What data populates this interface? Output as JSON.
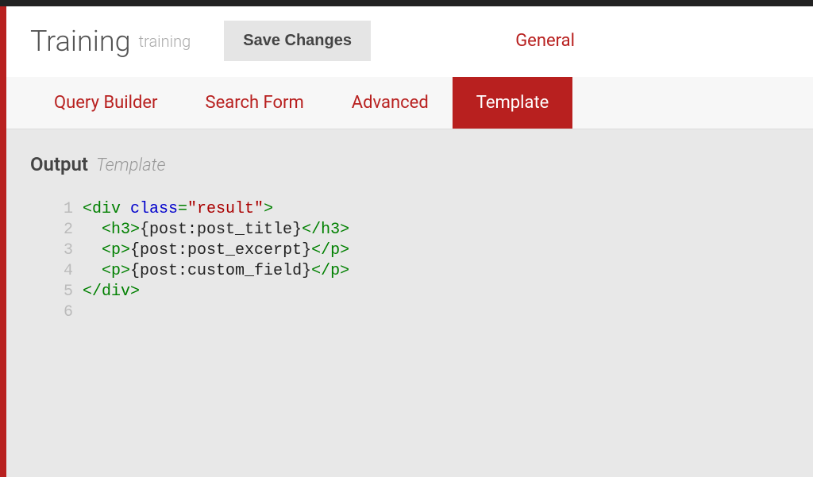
{
  "header": {
    "title": "Training",
    "subtitle": "training",
    "save_button": "Save Changes",
    "general_link": "General"
  },
  "tabs": [
    {
      "label": "Query Builder",
      "active": false
    },
    {
      "label": "Search Form",
      "active": false
    },
    {
      "label": "Advanced",
      "active": false
    },
    {
      "label": "Template",
      "active": true
    }
  ],
  "section": {
    "title": "Output",
    "subtitle": "Template"
  },
  "code": {
    "lines": [
      {
        "num": "1",
        "tokens": [
          {
            "t": "tag",
            "v": "<div "
          },
          {
            "t": "attr-name",
            "v": "class"
          },
          {
            "t": "tag",
            "v": "="
          },
          {
            "t": "attr-value",
            "v": "\"result\""
          },
          {
            "t": "tag",
            "v": ">"
          }
        ]
      },
      {
        "num": "2",
        "tokens": [
          {
            "t": "text",
            "v": "  "
          },
          {
            "t": "tag",
            "v": "<h3>"
          },
          {
            "t": "text",
            "v": "{post:post_title}"
          },
          {
            "t": "tag",
            "v": "</h3>"
          }
        ]
      },
      {
        "num": "3",
        "tokens": [
          {
            "t": "text",
            "v": "  "
          },
          {
            "t": "tag",
            "v": "<p>"
          },
          {
            "t": "text",
            "v": "{post:post_excerpt}"
          },
          {
            "t": "tag",
            "v": "</p>"
          }
        ]
      },
      {
        "num": "4",
        "tokens": [
          {
            "t": "text",
            "v": "  "
          },
          {
            "t": "tag",
            "v": "<p>"
          },
          {
            "t": "text",
            "v": "{post:custom_field}"
          },
          {
            "t": "tag",
            "v": "</p>"
          }
        ]
      },
      {
        "num": "5",
        "tokens": [
          {
            "t": "tag",
            "v": "</div>"
          }
        ]
      },
      {
        "num": "6",
        "tokens": []
      }
    ]
  }
}
